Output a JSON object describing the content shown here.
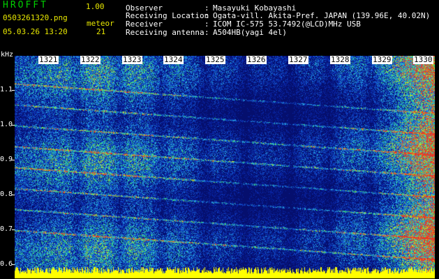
{
  "app": {
    "title": "HROFFT",
    "version": "1.00"
  },
  "file": {
    "name": "0503261320.png",
    "datetime": "05.03.26 13:20"
  },
  "meteor": {
    "label": "meteor",
    "count": "21"
  },
  "info": [
    {
      "key": "Observer",
      "sep": ":",
      "value": "Masayuki Kobayashi"
    },
    {
      "key": "Receiving Location",
      "sep": ":",
      "value": "Ogata-vill. Akita-Pref. JAPAN (139.96E, 40.02N)"
    },
    {
      "key": "Receiver",
      "sep": ":",
      "value": "ICOM IC-575 53.7492(@LCD)MHz USB"
    },
    {
      "key": "Receiving antenna",
      "sep": ":",
      "value": "A504HB(yagi 4el)"
    }
  ],
  "axis": {
    "unit": "kHz",
    "labels": [
      "1.1",
      "1.0",
      "0.9",
      "0.8",
      "0.7",
      "0.6"
    ]
  },
  "minutes": [
    "1321",
    "1322",
    "1323",
    "1324",
    "1325",
    "1326",
    "1327",
    "1328",
    "1329",
    "1330"
  ],
  "colors": {
    "text": "#ffffff",
    "accent": "#e8e800",
    "title": "#00d000",
    "background": "#000000",
    "noise": "#0b2a9c",
    "level": "#ffff00"
  }
}
